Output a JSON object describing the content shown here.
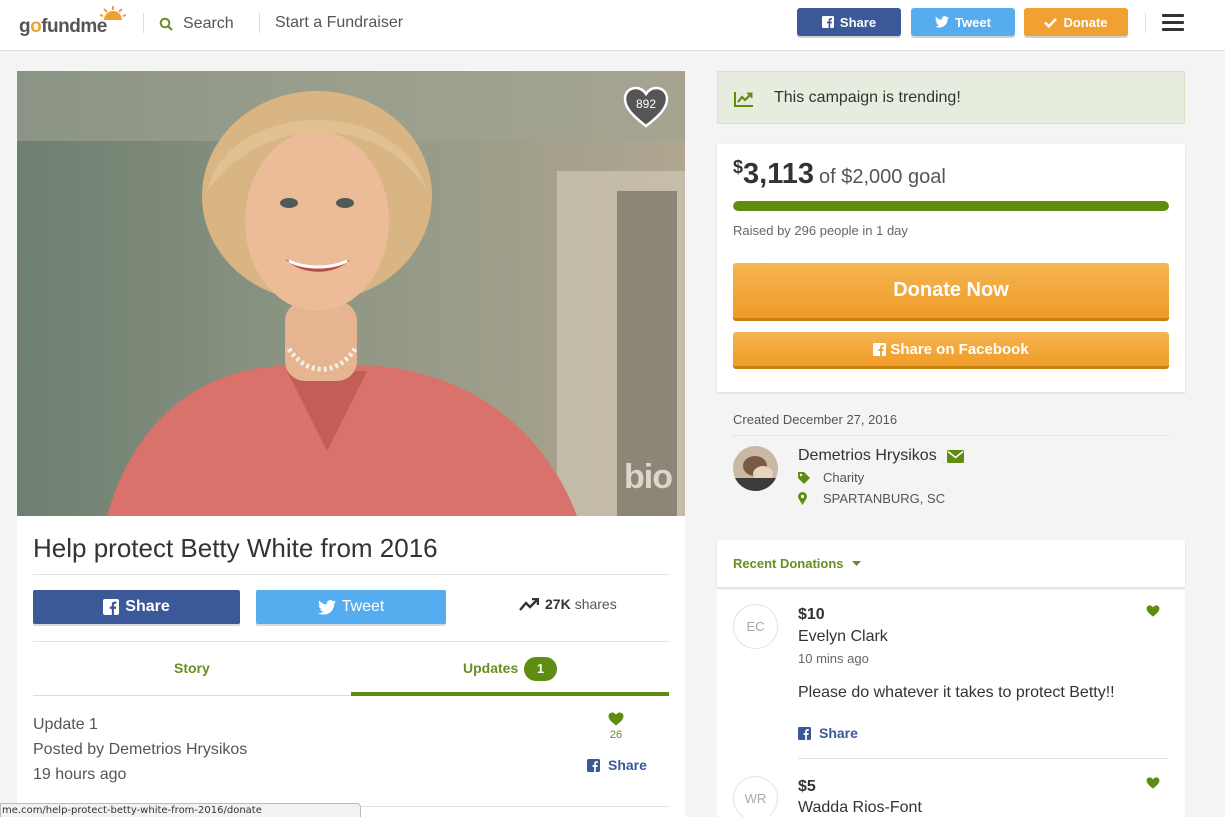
{
  "header": {
    "logo_text_a": "g",
    "logo_text_o": "o",
    "logo_text_b": "fundme",
    "search_label": "Search",
    "start_label": "Start a Fundraiser",
    "share_label": "Share",
    "tweet_label": "Tweet",
    "donate_label": "Donate"
  },
  "campaign": {
    "heart_count": "892",
    "photo_watermark": "bio",
    "title": "Help protect Betty White from 2016",
    "share_label": "Share",
    "tweet_label": "Tweet",
    "shares_count": "27K",
    "shares_label": "shares"
  },
  "tabs": {
    "story": "Story",
    "updates": "Updates",
    "updates_count": "1"
  },
  "update": {
    "heading": "Update 1",
    "posted_by": "Posted by Demetrios Hrysikos",
    "time": "19 hours ago",
    "likes": "26",
    "share_label": "Share"
  },
  "status_url": "me.com/help-protect-betty-white-from-2016/donate",
  "sidebar": {
    "trending": "This campaign is trending!",
    "currency": "$",
    "raised": "3,113",
    "goal_text": "of $2,000 goal",
    "progress_fraction": 1.0,
    "raised_by": "Raised by 296 people in 1 day",
    "donate_now": "Donate Now",
    "share_facebook": "Share on Facebook",
    "created": "Created December 27, 2016",
    "organizer": "Demetrios Hrysikos",
    "category": "Charity",
    "location": "SPARTANBURG, SC",
    "recent_donations": "Recent Donations"
  },
  "donations": [
    {
      "initials": "EC",
      "amount": "$10",
      "name": "Evelyn Clark",
      "time": "10 mins ago",
      "message": "Please do whatever it takes to protect Betty!!",
      "share_label": "Share"
    },
    {
      "initials": "WR",
      "amount": "$5",
      "name": "Wadda Rios-Font"
    }
  ],
  "colors": {
    "facebook": "#3b5998",
    "twitter": "#55acee",
    "donate_orange": "#f0a131",
    "brand_green": "#5e8d12"
  }
}
